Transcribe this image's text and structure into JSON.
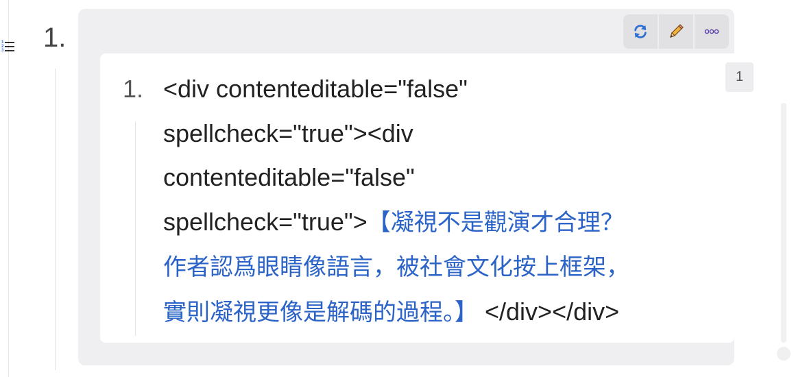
{
  "list": {
    "list_type_icon": "numbered-list-icon",
    "list_type_icon_digits": [
      "1",
      "2",
      "3"
    ],
    "outer_marker": "1.",
    "inner_marker": "1."
  },
  "toolbar": {
    "refresh_icon": "refresh-icon",
    "edit_icon": "pencil-icon",
    "more_icon": "more-icon",
    "refresh_color": "#2f6fd1",
    "edit_color": "#e39a2c"
  },
  "content": {
    "lines": [
      {
        "plain": "<div contenteditable=\"false\"",
        "cjk": "",
        "tail": ""
      },
      {
        "plain": "spellcheck=\"true\"><div",
        "cjk": "",
        "tail": ""
      },
      {
        "plain": "contenteditable=\"false\"",
        "cjk": "",
        "tail": ""
      },
      {
        "plain": "spellcheck=\"true\">",
        "cjk": "【凝視不是觀演才合理？",
        "tail": ""
      },
      {
        "plain": "",
        "cjk": "作者認爲眼睛像語言，被社會文化按上框架，",
        "tail": ""
      },
      {
        "plain": "",
        "cjk": "實則凝視更像是解碼的過程。】",
        "tail": " </div></div>"
      }
    ],
    "cjk_color": "#2b63c6"
  },
  "badge": {
    "count": "1"
  }
}
